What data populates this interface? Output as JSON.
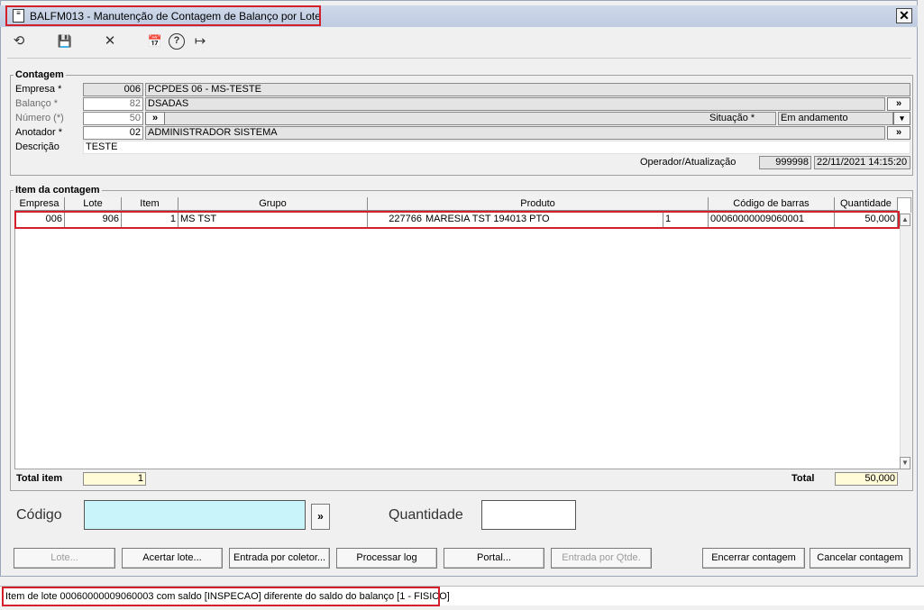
{
  "window": {
    "title": "BALFM013 - Manutenção de Contagem de Balanço por Lote",
    "close_glyph": "✕"
  },
  "toolbar": {
    "undo_glyph": "⟲",
    "save_glyph": "💾",
    "cancel_glyph": "✕",
    "calendar_glyph": "📅",
    "help_glyph": "?",
    "exit_glyph": "↦"
  },
  "contagem": {
    "title": "Contagem",
    "empresa": {
      "label": "Empresa *",
      "code": "006",
      "name": "PCPDES 06 - MS-TESTE"
    },
    "balanco": {
      "label": "Balanço *",
      "code": "82",
      "name": "DSADAS"
    },
    "numero": {
      "label": "Número (*)",
      "value": "50"
    },
    "situacao": {
      "label": "Situação *",
      "value": "Em andamento"
    },
    "anotador": {
      "label": "Anotador *",
      "code": "02",
      "name": "ADMINISTRADOR SISTEMA"
    },
    "descricao": {
      "label": "Descrição",
      "value": "TESTE"
    },
    "operador": {
      "label": "Operador/Atualização",
      "code": "999998",
      "datetime": "22/11/2021 14:15:20"
    },
    "more_glyph": "»",
    "dropdown_glyph": "▾"
  },
  "itens": {
    "title": "Item da contagem",
    "columns": [
      "Empresa",
      "Lote",
      "Item",
      "Grupo",
      "Produto",
      "Código de barras",
      "Quantidade"
    ],
    "row": {
      "empresa": "006",
      "lote": "906",
      "item": "1",
      "grupo": "MS TST",
      "produto_cod": "227766",
      "produto_desc": "MARESIA TST 194013 PTO",
      "produto_un": "1",
      "codigo_barras": "00060000009060001",
      "quantidade": "50,000"
    },
    "scroll_up": "▲",
    "scroll_down": "▼"
  },
  "totals": {
    "item_label": "Total item",
    "item_value": "1",
    "total_label": "Total",
    "total_value": "50,000"
  },
  "entry": {
    "codigo_label": "Código",
    "codigo_value": "",
    "quantidade_label": "Quantidade",
    "quantidade_value": ""
  },
  "buttons": {
    "lote": "Lote...",
    "acertar": "Acertar lote...",
    "coletor": "Entrada por coletor...",
    "processar": "Processar log",
    "portal": "Portal...",
    "qtde": "Entrada por Qtde.",
    "encerrar": "Encerrar contagem",
    "cancelar": "Cancelar contagem"
  },
  "status": {
    "message": "Item de lote 00060000009060003 com saldo [INSPECAO] diferente do saldo do balanço [1 - FISICO]"
  },
  "colors": {
    "highlight": "#d4202a",
    "codigo_bg": "#c8f4fa",
    "total_bg": "#fffad8",
    "title_bg": "#c5d1e6"
  }
}
